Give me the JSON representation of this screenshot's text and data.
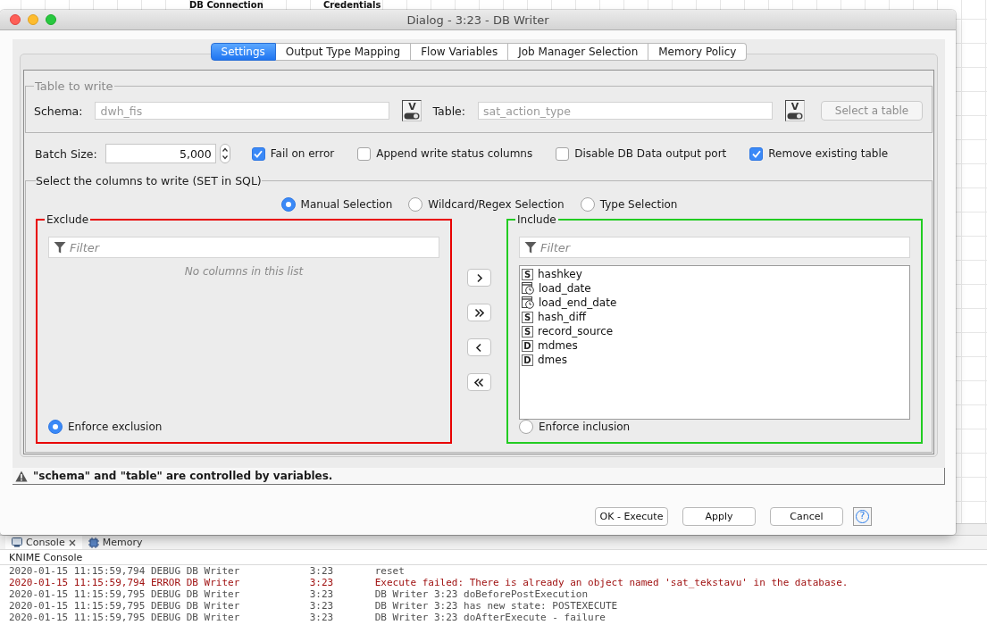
{
  "workbench": {
    "canvas_nodes": [
      {
        "label": "DB Connection"
      },
      {
        "label": "Credentials"
      }
    ],
    "console_tabs": [
      {
        "kind": "console",
        "label": "Console",
        "selected": true
      },
      {
        "kind": "memory",
        "label": "Memory",
        "selected": false
      }
    ],
    "console": {
      "title": "KNIME Console",
      "lines": [
        {
          "kind": "debug",
          "timestamp": "2020-01-15 11:15:59,794",
          "severity": "DEBUG",
          "category": "DB Writer",
          "node": "3:23",
          "message": "reset"
        },
        {
          "kind": "error",
          "timestamp": "2020-01-15 11:15:59,794",
          "severity": "ERROR",
          "category": "DB Writer",
          "node": "3:23",
          "message": "Execute failed: There is already an object named 'sat_tekstavu' in the database."
        },
        {
          "kind": "debug",
          "timestamp": "2020-01-15 11:15:59,795",
          "severity": "DEBUG",
          "category": "DB Writer",
          "node": "3:23",
          "message": "DB Writer 3:23 doBeforePostExecution"
        },
        {
          "kind": "debug",
          "timestamp": "2020-01-15 11:15:59,795",
          "severity": "DEBUG",
          "category": "DB Writer",
          "node": "3:23",
          "message": "DB Writer 3:23 has new state: POSTEXECUTE"
        },
        {
          "kind": "debug",
          "timestamp": "2020-01-15 11:15:59,795",
          "severity": "DEBUG",
          "category": "DB Writer",
          "node": "3:23",
          "message": "DB Writer 3:23 doAfterExecute - failure"
        }
      ]
    }
  },
  "dialog": {
    "title": "Dialog - 3:23 - DB Writer",
    "tabs": [
      {
        "label": "Settings",
        "selected": true
      },
      {
        "label": "Output Type Mapping",
        "selected": false
      },
      {
        "label": "Flow Variables",
        "selected": false
      },
      {
        "label": "Job Manager Selection",
        "selected": false
      },
      {
        "label": "Memory Policy",
        "selected": false
      }
    ],
    "table_to_write": {
      "title": "Table to write",
      "fields": [
        {
          "label": "Schema:",
          "value": "dwh_fis",
          "disabled": true,
          "variable_glyph": "V"
        },
        {
          "label": "Table:",
          "value": "sat_action_type",
          "disabled": true,
          "variable_glyph": "V"
        }
      ],
      "select_button": {
        "label": "Select a table",
        "disabled": true
      }
    },
    "batch_size": {
      "label": "Batch Size:",
      "value": "5,000"
    },
    "options": [
      {
        "label": "Fail on error",
        "checked": true
      },
      {
        "label": "Append write status columns",
        "checked": false
      },
      {
        "label": "Disable DB Data output port",
        "checked": false
      },
      {
        "label": "Remove existing table",
        "checked": true
      }
    ],
    "column_selection": {
      "title": "Select the columns to write (SET in SQL)",
      "modes": [
        {
          "label": "Manual Selection",
          "selected": true
        },
        {
          "label": "Wildcard/Regex Selection",
          "selected": false
        },
        {
          "label": "Type Selection",
          "selected": false
        }
      ],
      "lists": [
        {
          "title": "Exclude",
          "color": "#e80000",
          "filter": {
            "placeholder": "Filter"
          },
          "empty_text": "No columns in this list",
          "enforce": {
            "label": "Enforce exclusion",
            "selected": true
          }
        },
        {
          "title": "Include",
          "color": "#22cc22",
          "filter": {
            "placeholder": "Filter"
          },
          "columns": [
            {
              "kind": "string",
              "badge": "S",
              "name": "hashkey",
              "selected": false
            },
            {
              "kind": "date",
              "name": "load_date",
              "selected": false
            },
            {
              "kind": "date",
              "name": "load_end_date",
              "selected": false
            },
            {
              "kind": "string",
              "badge": "S",
              "name": "hash_diff",
              "selected": false
            },
            {
              "kind": "string",
              "badge": "S",
              "name": "record_source",
              "selected": false
            },
            {
              "kind": "double",
              "badge": "D",
              "name": "mdmes",
              "selected": false
            },
            {
              "kind": "double",
              "badge": "D",
              "name": "dmes",
              "selected": false
            }
          ],
          "enforce": {
            "label": "Enforce inclusion",
            "selected": false
          }
        }
      ],
      "move_buttons": [
        {
          "kind": "add"
        },
        {
          "kind": "add_all"
        },
        {
          "kind": "remove"
        },
        {
          "kind": "remove_all"
        }
      ]
    },
    "warning": {
      "text": "\"schema\" and \"table\" are controlled by variables."
    },
    "buttons": [
      {
        "label": "OK - Execute"
      },
      {
        "label": "Apply"
      },
      {
        "label": "Cancel"
      }
    ],
    "help_button": {
      "label": "?"
    }
  }
}
